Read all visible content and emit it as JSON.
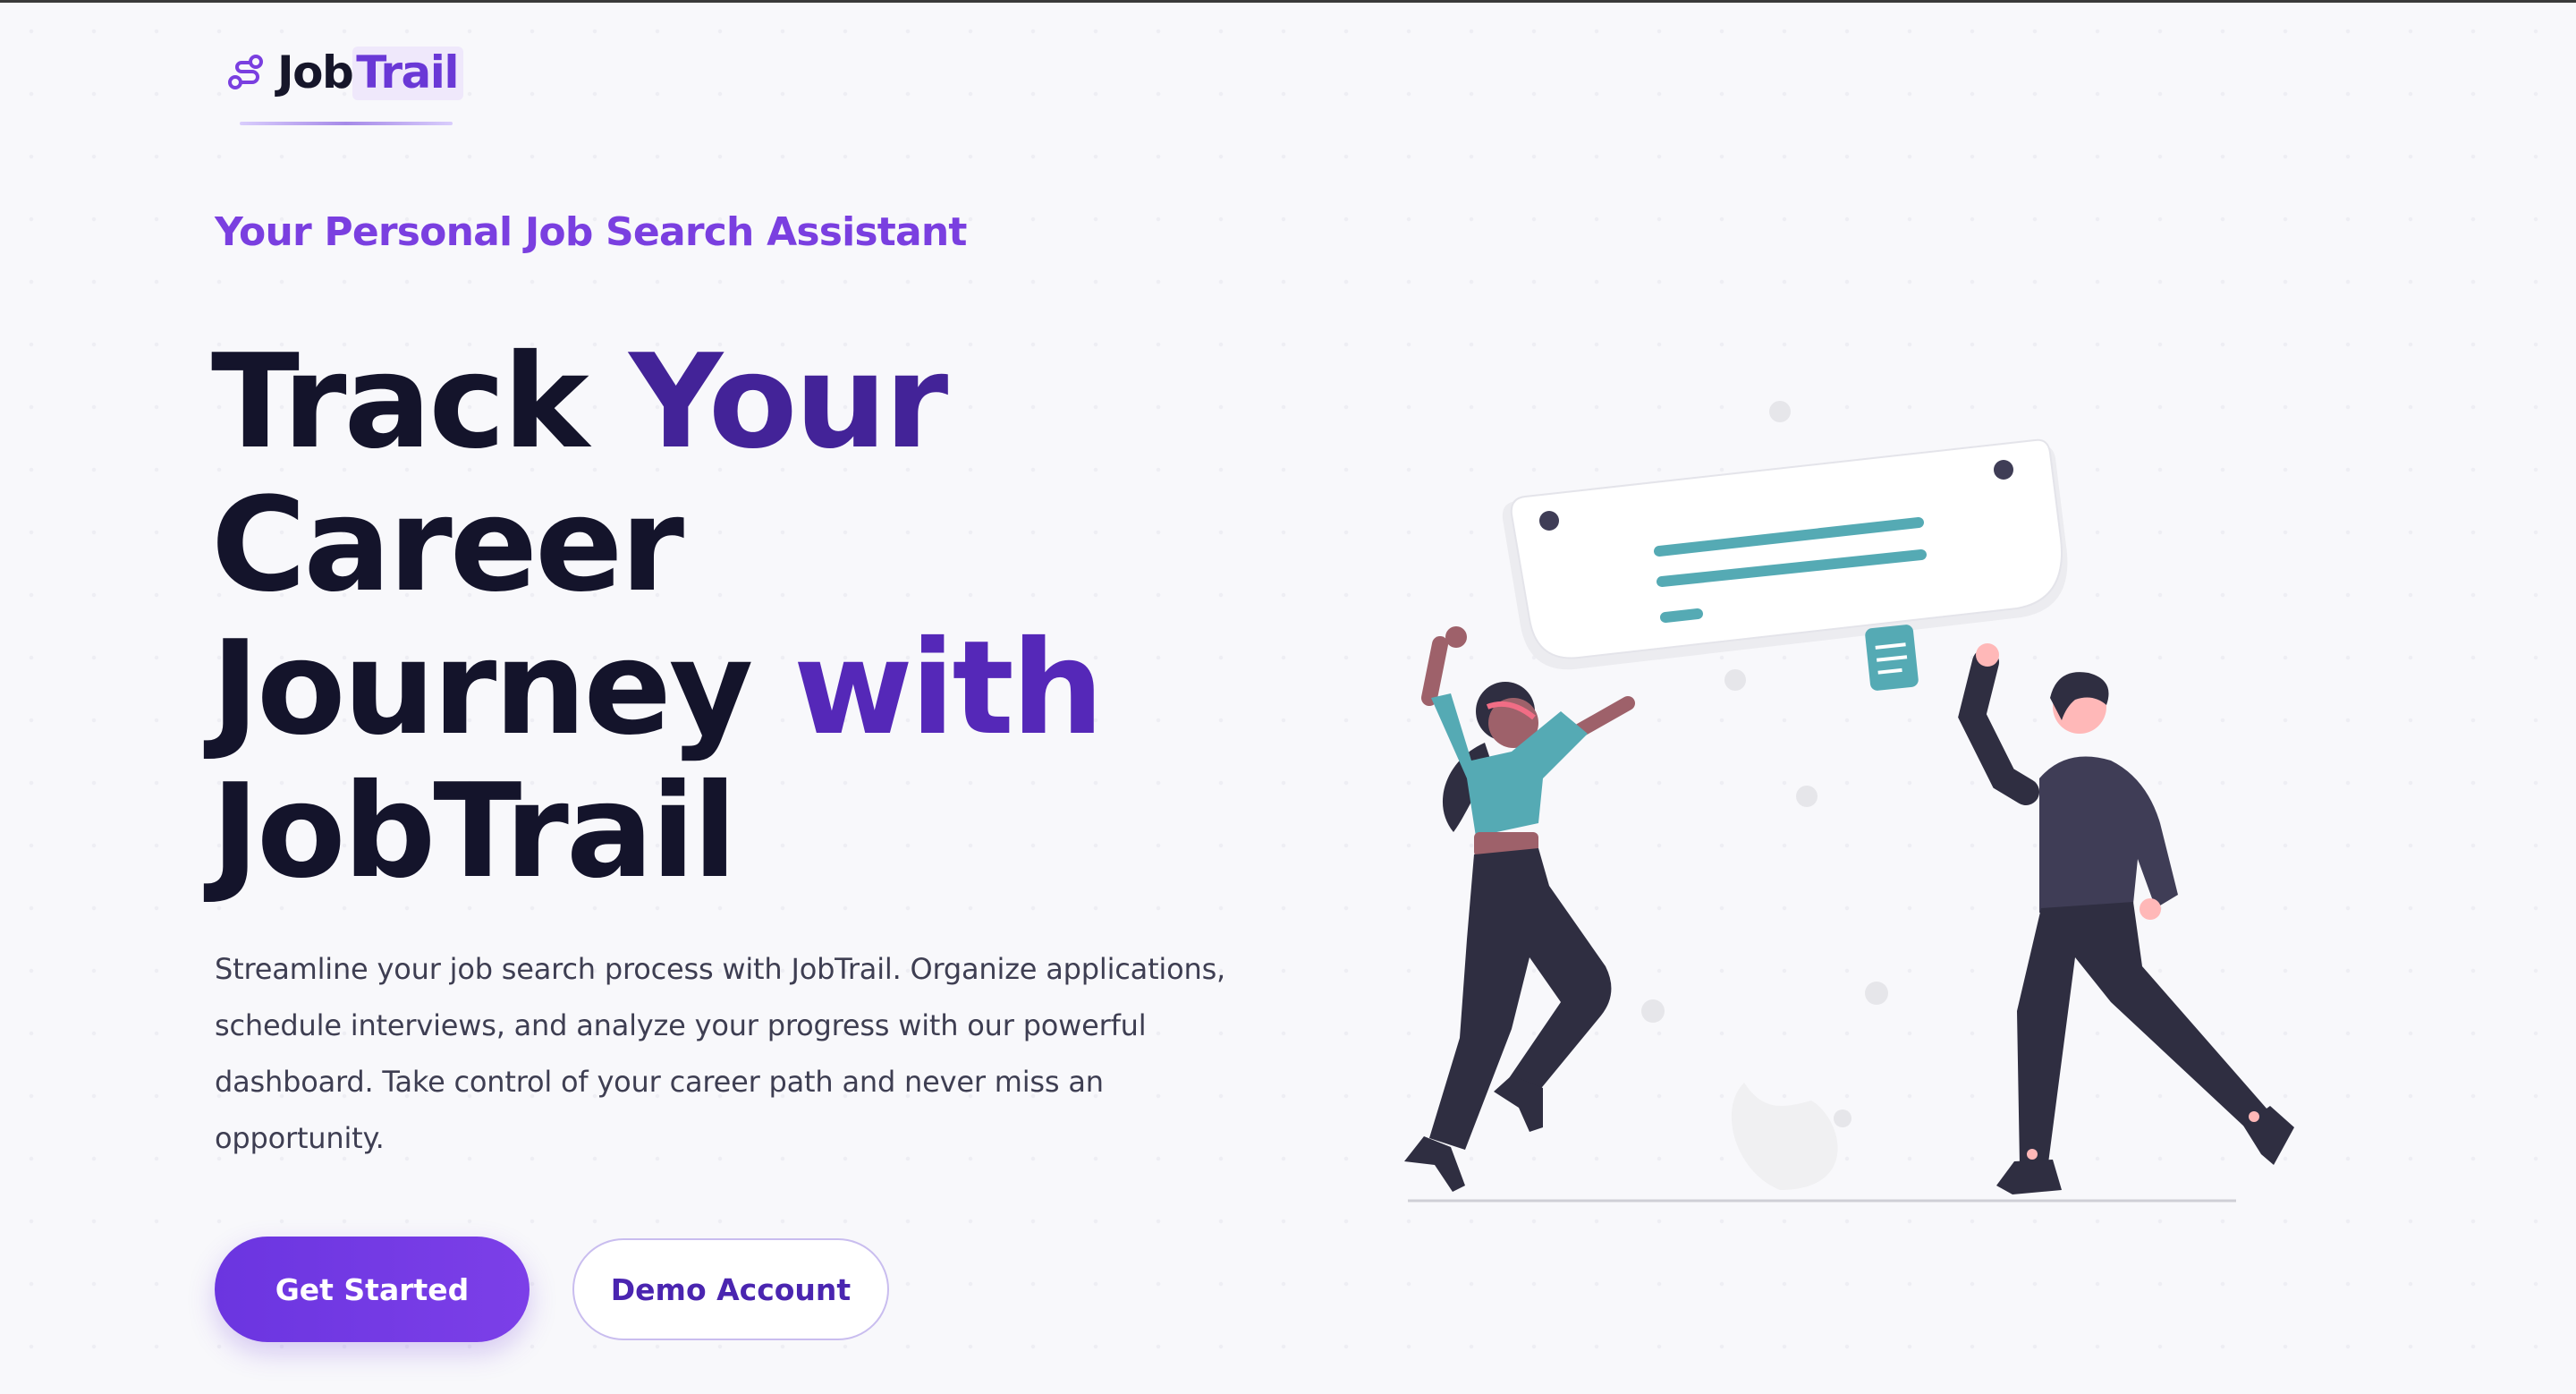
{
  "brand": {
    "name_part1": "Job",
    "name_part2": "Trail",
    "icon": "route-icon",
    "accent_color": "#7a3fe0"
  },
  "hero": {
    "tagline": "Your Personal Job Search Assistant",
    "headline": {
      "line1_a": "Track ",
      "line1_b": "Your",
      "line2": "Career",
      "line3_a": "Journey ",
      "line3_b": "with",
      "line4": "JobTrail"
    },
    "description": "Streamline your job search process with JobTrail. Organize applications, schedule interviews, and analyze your progress with our powerful dashboard. Take control of your career path and never miss an opportunity."
  },
  "actions": {
    "primary_label": "Get Started",
    "secondary_label": "Demo Account"
  },
  "illustration": {
    "name": "people-holding-sign-illustration",
    "colors": {
      "teal": "#55aab4",
      "dark": "#2f2e41",
      "skin_dark": "#9e616a",
      "skin_light": "#ffb8b8",
      "sign": "#ffffff"
    }
  }
}
